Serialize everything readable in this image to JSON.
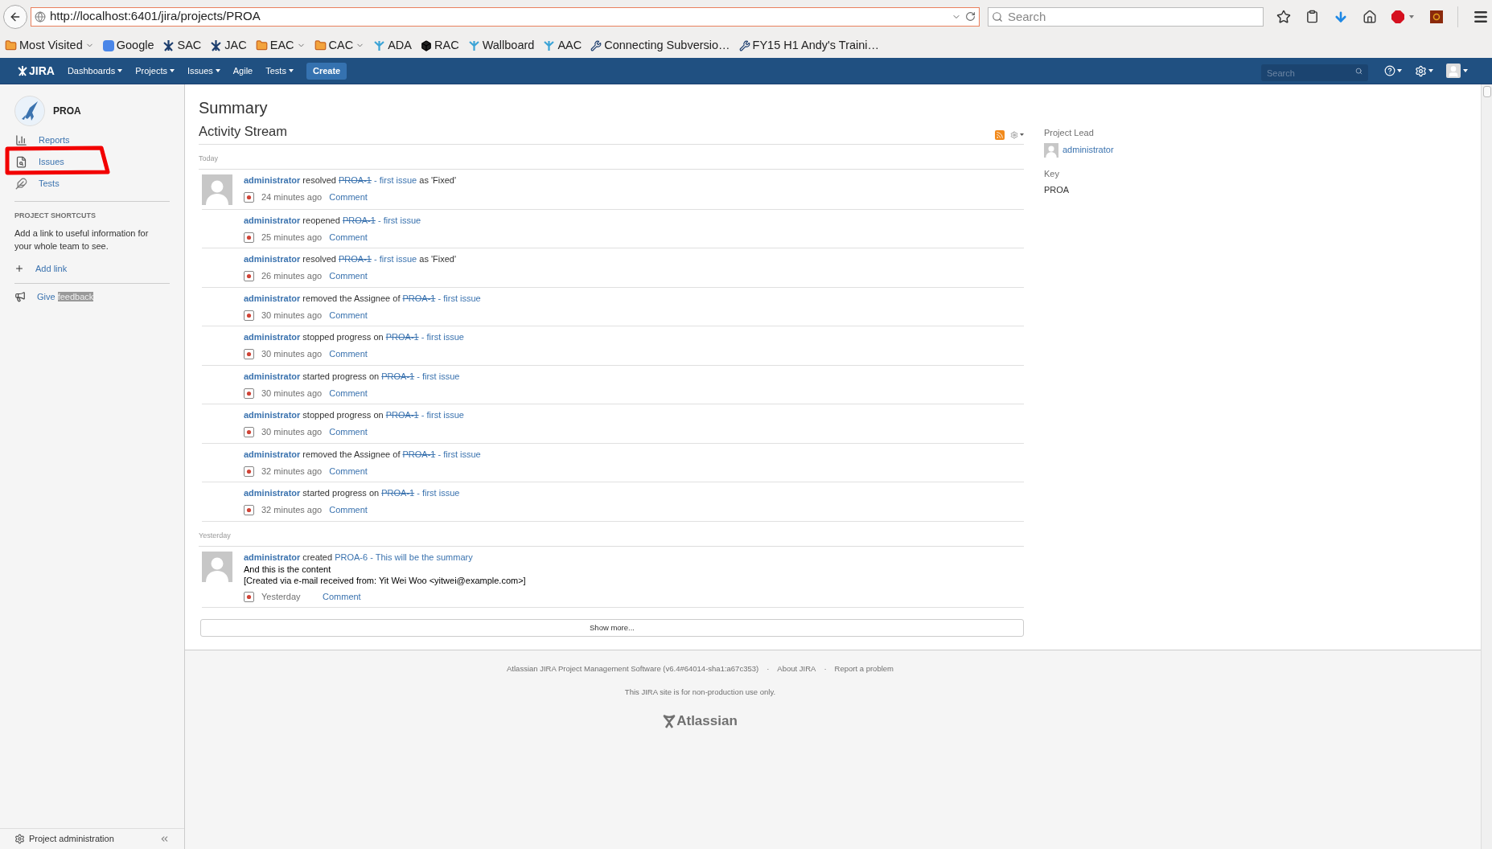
{
  "browser": {
    "url": "http://localhost:6401/jira/projects/PROA",
    "search_placeholder": "Search"
  },
  "bookmarks": [
    {
      "label": "Most Visited",
      "kind": "folder",
      "dropdown": true
    },
    {
      "label": "Google",
      "kind": "google",
      "dropdown": false
    },
    {
      "label": "SAC",
      "kind": "jira",
      "dropdown": false
    },
    {
      "label": "JAC",
      "kind": "jira",
      "dropdown": false
    },
    {
      "label": "EAC",
      "kind": "folder",
      "dropdown": true
    },
    {
      "label": "CAC",
      "kind": "folder",
      "dropdown": true
    },
    {
      "label": "ADA",
      "kind": "confluence",
      "dropdown": false
    },
    {
      "label": "RAC",
      "kind": "cube",
      "dropdown": false
    },
    {
      "label": "Wallboard",
      "kind": "confluence",
      "dropdown": false
    },
    {
      "label": "AAC",
      "kind": "confluence",
      "dropdown": false
    },
    {
      "label": "Connecting Subversio…",
      "kind": "tools",
      "dropdown": false
    },
    {
      "label": "FY15 H1 Andy's Traini…",
      "kind": "tools",
      "dropdown": false
    }
  ],
  "app_header": {
    "logo": "JIRA",
    "nav": [
      {
        "label": "Dashboards",
        "dropdown": true
      },
      {
        "label": "Projects",
        "dropdown": true
      },
      {
        "label": "Issues",
        "dropdown": true
      },
      {
        "label": "Agile",
        "dropdown": false
      },
      {
        "label": "Tests",
        "dropdown": true
      }
    ],
    "create_label": "Create",
    "search_placeholder": "Search"
  },
  "sidebar": {
    "project": "PROA",
    "items": [
      {
        "label": "Reports",
        "kind": "reports",
        "selected": false
      },
      {
        "label": "Issues",
        "kind": "issues",
        "selected": false
      },
      {
        "label": "Tests",
        "kind": "tests",
        "selected": false
      }
    ],
    "shortcuts_heading": "PROJECT SHORTCUTS",
    "shortcuts_text": "Add a link to useful information for your whole team to see.",
    "add_link": "Add link",
    "feedback": {
      "label": "Give",
      "highlighted": "feedback"
    },
    "admin": "Project administration"
  },
  "page_title": "Summary",
  "activity": {
    "title": "Activity Stream",
    "groups": [
      {
        "label": "Today",
        "items": [
          {
            "avatar": true,
            "actor": "administrator",
            "action": "resolved",
            "issue_key": "PROA-1",
            "resolved": true,
            "summary": "- first issue",
            "suffix": "as 'Fixed'",
            "time": "24 minutes ago",
            "comment": "Comment"
          },
          {
            "avatar": false,
            "actor": "administrator",
            "action": "reopened",
            "issue_key": "PROA-1",
            "resolved": true,
            "summary": "- first issue",
            "time": "25 minutes ago",
            "comment": "Comment"
          },
          {
            "avatar": false,
            "actor": "administrator",
            "action": "resolved",
            "issue_key": "PROA-1",
            "resolved": true,
            "summary": "- first issue",
            "suffix": "as 'Fixed'",
            "time": "26 minutes ago",
            "comment": "Comment"
          },
          {
            "avatar": false,
            "actor": "administrator",
            "action": "removed the Assignee of",
            "issue_key": "PROA-1",
            "resolved": true,
            "summary": "- first issue",
            "time": "30 minutes ago",
            "comment": "Comment"
          },
          {
            "avatar": false,
            "actor": "administrator",
            "action": "stopped progress on",
            "issue_key": "PROA-1",
            "resolved": true,
            "summary": "- first issue",
            "time": "30 minutes ago",
            "comment": "Comment"
          },
          {
            "avatar": false,
            "actor": "administrator",
            "action": "started progress on",
            "issue_key": "PROA-1",
            "resolved": true,
            "summary": "- first issue",
            "time": "30 minutes ago",
            "comment": "Comment"
          },
          {
            "avatar": false,
            "actor": "administrator",
            "action": "stopped progress on",
            "issue_key": "PROA-1",
            "resolved": true,
            "summary": "- first issue",
            "time": "30 minutes ago",
            "comment": "Comment"
          },
          {
            "avatar": false,
            "actor": "administrator",
            "action": "removed the Assignee of",
            "issue_key": "PROA-1",
            "resolved": true,
            "summary": "- first issue",
            "time": "32 minutes ago",
            "comment": "Comment"
          },
          {
            "avatar": false,
            "actor": "administrator",
            "action": "started progress on",
            "issue_key": "PROA-1",
            "resolved": true,
            "summary": "- first issue",
            "time": "32 minutes ago",
            "comment": "Comment"
          }
        ]
      },
      {
        "label": "Yesterday",
        "items": [
          {
            "avatar": true,
            "actor": "administrator",
            "action": "created",
            "issue_key": "PROA-6",
            "resolved": false,
            "summary": "- This will be the summary",
            "content": [
              "And this is the content",
              "[Created via e-mail received from: Yit Wei Woo <yitwei@example.com>]"
            ],
            "time": "Yesterday",
            "comment": "Comment"
          }
        ]
      }
    ],
    "show_more": "Show more..."
  },
  "project_info": [
    {
      "label": "Project Lead",
      "kind": "user",
      "value": "administrator"
    },
    {
      "label": "Key",
      "kind": "text",
      "value": "PROA"
    }
  ],
  "footer": {
    "version": "Atlassian JIRA Project Management Software (v6.4#64014-sha1:a67c353)",
    "links": [
      {
        "separator": "·",
        "label": "About JIRA"
      },
      {
        "separator": "·",
        "label": "Report a problem"
      }
    ],
    "note": "This JIRA site is for non-production use only.",
    "logo": "Atlassian"
  }
}
